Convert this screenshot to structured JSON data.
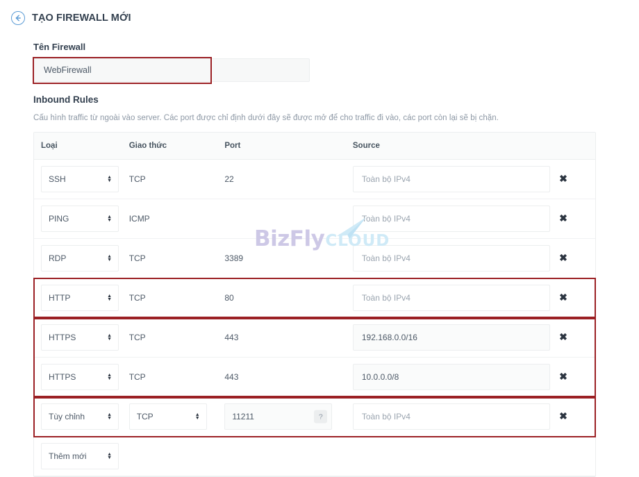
{
  "header": {
    "back_icon": "back-arrow-circle-icon",
    "title": "TẠO FIREWALL MỚI"
  },
  "firewall_name": {
    "label": "Tên Firewall",
    "value": "WebFirewall",
    "placeholder": "Tên Firewall"
  },
  "inbound": {
    "label": "Inbound Rules",
    "description": "Cấu hình traffic từ ngoài vào server. Các port được chỉ định dưới đây sẽ được mở để cho traffic đi vào, các port còn lại sẽ bị chặn.",
    "columns": {
      "type": "Loại",
      "protocol": "Giao thức",
      "port": "Port",
      "source": "Source"
    },
    "source_placeholder": "Toàn bộ IPv4",
    "help_label": "?",
    "delete_icon": "✖",
    "rows": [
      {
        "type": "SSH",
        "protocol": "TCP",
        "port": "22",
        "source": "",
        "source_placeholder": "Toàn bộ IPv4",
        "highlighted": false
      },
      {
        "type": "PING",
        "protocol": "ICMP",
        "port": "",
        "source": "",
        "source_placeholder": "Toàn bộ IPv4",
        "highlighted": false
      },
      {
        "type": "RDP",
        "protocol": "TCP",
        "port": "3389",
        "source": "",
        "source_placeholder": "Toàn bộ IPv4",
        "highlighted": false
      },
      {
        "type": "HTTP",
        "protocol": "TCP",
        "port": "80",
        "source": "",
        "source_placeholder": "Toàn bộ IPv4",
        "highlighted": true
      },
      {
        "type": "HTTPS",
        "protocol": "TCP",
        "port": "443",
        "source": "192.168.0.0/16",
        "source_placeholder": "Toàn bộ IPv4",
        "highlighted": true
      },
      {
        "type": "HTTPS",
        "protocol": "TCP",
        "port": "443",
        "source": "10.0.0.0/8",
        "source_placeholder": "Toàn bộ IPv4",
        "highlighted": true
      },
      {
        "type": "Tùy chỉnh",
        "protocol": "TCP",
        "port": "11211",
        "source": "",
        "source_placeholder": "Toàn bộ IPv4",
        "highlighted": true
      }
    ],
    "add_row_label": "Thêm mới"
  },
  "watermark": {
    "brand": "BizFly",
    "suffix": "CLOUD"
  },
  "colors": {
    "accent_blue": "#5b9bd5",
    "annotation_red": "#9b2024",
    "text_dark": "#33404f",
    "text_muted": "#8d98a5",
    "border": "#eceeef",
    "watermark_purple": "#cdc8e6",
    "watermark_cyan": "#cfeaf7"
  }
}
